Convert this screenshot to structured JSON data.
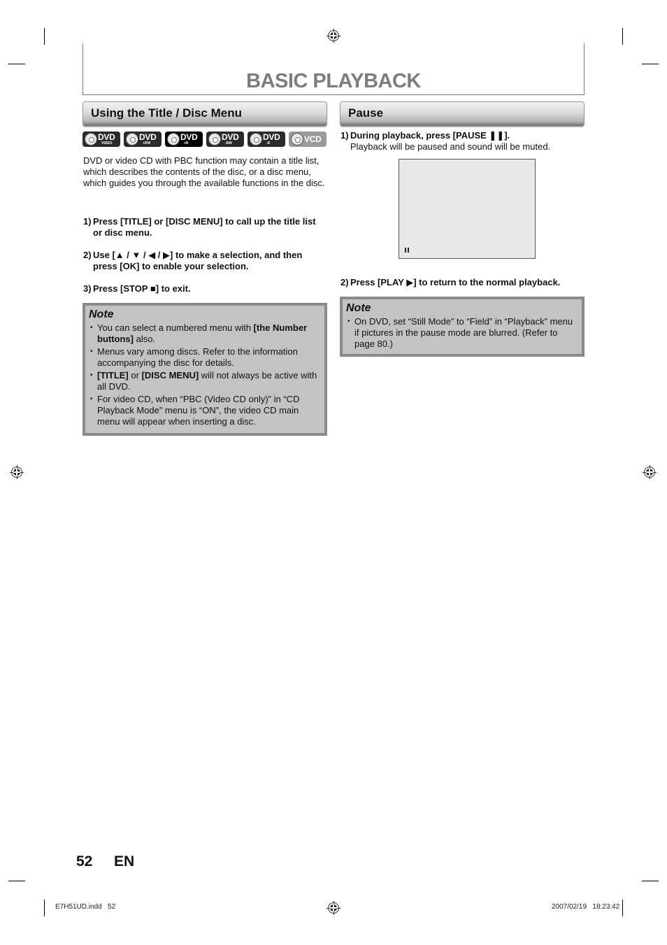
{
  "header": {
    "title": "BASIC PLAYBACK"
  },
  "left_section": {
    "heading": "Using the Title / Disc Menu",
    "disc_icons": [
      {
        "icon": "dvd-video-icon",
        "label": "DVD",
        "sub": "VIDEO"
      },
      {
        "icon": "dvd-plus-rw-icon",
        "label": "DVD",
        "sub": "+RW"
      },
      {
        "icon": "dvd-plus-r-icon",
        "label": "DVD",
        "sub": "+R"
      },
      {
        "icon": "dvd-minus-rw-icon",
        "label": "DVD",
        "sub": "-RW"
      },
      {
        "icon": "dvd-minus-r-icon",
        "label": "DVD",
        "sub": "-R"
      },
      {
        "icon": "vcd-icon",
        "label": "VCD",
        "sub": ""
      }
    ],
    "intro": "DVD or video CD with PBC function may contain a title list, which describes the contents of the disc, or a disc menu, which guides you through the available functions in the disc.",
    "steps": [
      {
        "num": "1)",
        "text": "Press [TITLE] or [DISC MENU] to call up the title list or disc menu."
      },
      {
        "num": "2)",
        "text": "Use [▲ / ▼ / ◀ / ▶] to make a selection, and then press [OK] to enable your selection."
      },
      {
        "num": "3)",
        "text": "Press [STOP ■] to exit."
      }
    ],
    "note": {
      "title": "Note",
      "items": [
        {
          "pre": "You can select a numbered menu with ",
          "bold": "[the Number buttons]",
          "post": " also."
        },
        {
          "pre": "",
          "bold": "",
          "post": "Menus vary among discs. Refer to the information accompanying the disc for details."
        },
        {
          "pre": "",
          "bold": "[TITLE]",
          "post": " or ",
          "bold2": "[DISC MENU]",
          "post2": " will not always be active with all DVD."
        },
        {
          "pre": "",
          "bold": "",
          "post": "For video CD, when “PBC (Video CD only)” in “CD Playback Mode” menu is “ON”, the video CD main menu will appear when inserting a disc."
        }
      ]
    }
  },
  "right_section": {
    "heading": "Pause",
    "steps": [
      {
        "num": "1)",
        "text": "During playback, press [PAUSE ❚❚].",
        "sub": "Playback will be paused and sound will be muted."
      },
      {
        "num": "2)",
        "text": "Press [PLAY ▶] to return to the normal playback."
      }
    ],
    "screen": {
      "indicator": "pause-icon"
    },
    "note": {
      "title": "Note",
      "items": [
        "On DVD, set “Still Mode” to “Field” in “Playback” menu if pictures in the pause mode are blurred. (Refer to page 80.)"
      ]
    }
  },
  "footer": {
    "page_number": "52",
    "language": "EN",
    "file_slug": "E7H51UD.indd   52",
    "timestamp": "2007/02/19   18:23:42"
  }
}
